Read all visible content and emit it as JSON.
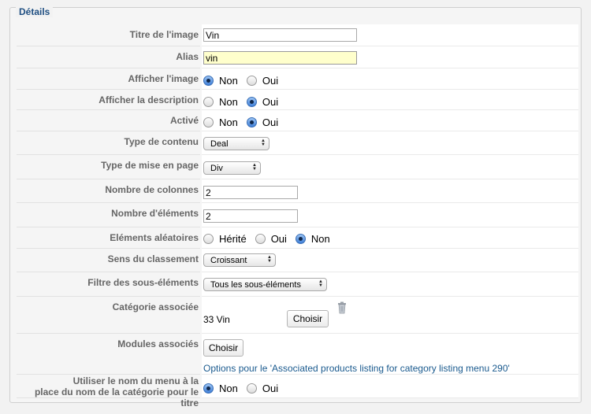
{
  "fieldset": {
    "legend": "Détails"
  },
  "fields": {
    "title": {
      "label": "Titre de l'image",
      "value": "Vin"
    },
    "alias": {
      "label": "Alias",
      "value": "vin"
    },
    "show_image": {
      "label": "Afficher l'image",
      "options": [
        "Non",
        "Oui"
      ],
      "selected": "Non"
    },
    "show_description": {
      "label": "Afficher la description",
      "options": [
        "Non",
        "Oui"
      ],
      "selected": "Oui"
    },
    "active": {
      "label": "Activé",
      "options": [
        "Non",
        "Oui"
      ],
      "selected": "Oui"
    },
    "content_type": {
      "label": "Type de contenu",
      "value": "Deal"
    },
    "layout_type": {
      "label": "Type de mise en page",
      "value": "Div"
    },
    "columns": {
      "label": "Nombre de colonnes",
      "value": "2"
    },
    "items": {
      "label": "Nombre d'éléments",
      "value": "2"
    },
    "random": {
      "label": "Eléments aléatoires",
      "options": [
        "Hérité",
        "Oui",
        "Non"
      ],
      "selected": "Non"
    },
    "sort": {
      "label": "Sens du classement",
      "value": "Croissant"
    },
    "subitems": {
      "label": "Filtre des sous-éléments",
      "value": "Tous les sous-éléments"
    },
    "category": {
      "label": "Catégorie associée",
      "value": "33 Vin",
      "button": "Choisir"
    },
    "modules": {
      "label": "Modules associés",
      "button": "Choisir",
      "link": "Options pour le 'Associated products listing for category listing menu 290'"
    },
    "use_menu_name": {
      "label_line1": "Utiliser le nom du menu à la",
      "label_line2": "place du nom de la catégorie pour le titre",
      "options": [
        "Non",
        "Oui"
      ],
      "selected": "Non"
    }
  }
}
